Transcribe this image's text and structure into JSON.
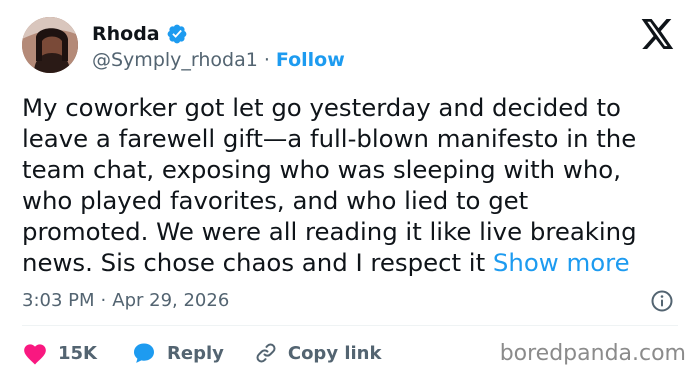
{
  "author": {
    "name": "Rhoda",
    "handle": "@Symply_rhoda1",
    "separator": "·",
    "follow_label": "Follow"
  },
  "tweet": {
    "text": "My coworker got let go yesterday and decided to\nleave a farewell gift—a full-blown manifesto in the\nteam chat, exposing who was sleeping with who,\nwho played favorites, and who lied to get\npromoted. We were all reading it like live breaking\nnews. Sis chose chaos and I respect it ",
    "show_more_label": "Show more",
    "time": "3:03 PM",
    "date_separator": "·",
    "date": "Apr 29, 2026"
  },
  "actions": {
    "likes_count": "15K",
    "reply_label": "Reply",
    "copy_link_label": "Copy link"
  },
  "watermark": "boredpanda.com",
  "colors": {
    "accent": "#1d9bf0",
    "like": "#f91880",
    "secondary_text": "#536471",
    "primary_text": "#0f1419"
  },
  "icons": {
    "verified": "verified-badge-icon",
    "logo": "x-logo-icon",
    "info": "info-icon",
    "like": "heart-icon",
    "reply": "speech-bubble-icon",
    "copy_link": "link-icon"
  }
}
